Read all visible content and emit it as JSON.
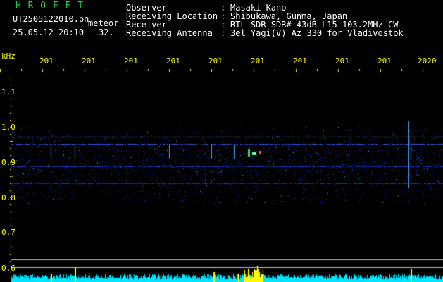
{
  "header": {
    "app_title": "H R O F F T",
    "file_name": "UT2505122010.pn",
    "category": "meteor",
    "timestamp": "25.05.12 20:10",
    "count": "32.",
    "fields": [
      {
        "label": "Observer",
        "value": "Masaki Kano"
      },
      {
        "label": "Receiving Location",
        "value": "Shibukawa, Gunma, Japan"
      },
      {
        "label": "Receiver",
        "value": "RTL-SDR SDR# 43dB L15 103.2MHz CW"
      },
      {
        "label": "Receiving Antenna",
        "value": "3el Yagi(V) Az 330 for Vladivostok"
      }
    ]
  },
  "axis": {
    "unit": "kHz",
    "y_ticks": [
      "1.1",
      "1.0",
      "0.9",
      "0.8",
      "0.7",
      "0.6"
    ],
    "time_ticks": [
      "201",
      "201",
      "201",
      "201",
      "201",
      "201",
      "201",
      "201",
      "201",
      "2020"
    ]
  },
  "colors": {
    "background": "#000000",
    "header_text": "#ffffff",
    "title_green": "#22d633",
    "axis_yellow": "#ffff00",
    "signal_cyan": "#00e5ff",
    "grid": "#ffffff"
  }
}
